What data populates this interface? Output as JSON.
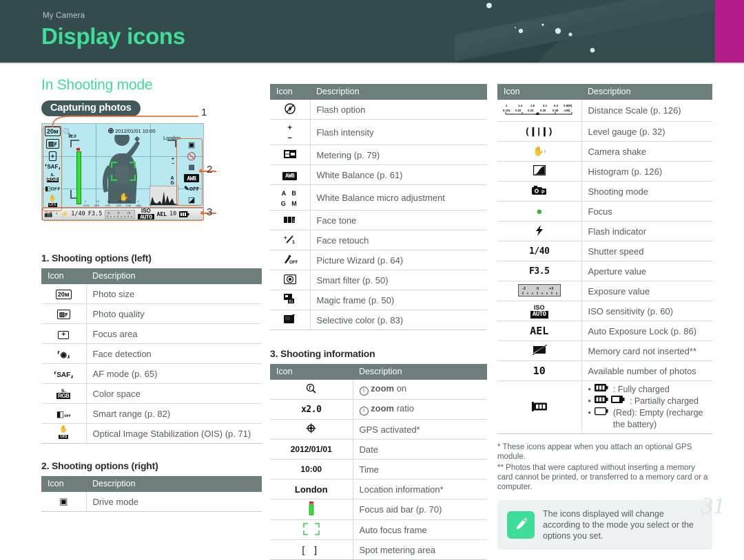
{
  "header": {
    "breadcrumb": "My Camera",
    "title": "Display icons",
    "accent_green": "#3fdd98",
    "bg": "#334b4c",
    "magenta": "#b41c8a"
  },
  "page_number": "31",
  "section": {
    "title": "In Shooting mode",
    "pill": "Capturing photos"
  },
  "callouts": {
    "one": "1",
    "two": "2",
    "three": "3"
  },
  "camera_screen": {
    "date": "2012/01/01",
    "time": "10:00",
    "location": "London",
    "zoom_ratio": "x2.0",
    "shutter_speed": "1/40",
    "aperture": "F3.5",
    "exposure_labels": [
      "-3",
      "0",
      "+3"
    ],
    "ael": "AEL",
    "photos_left": "10",
    "dist_top": [
      "1",
      "1.4",
      "1.9",
      "3.1",
      "6.4",
      "0.8(M)"
    ],
    "dist_bottom": [
      "0.101",
      "0.20",
      "0.23",
      "0.29",
      "0.48",
      "∞(M)"
    ]
  },
  "tables": {
    "left": {
      "caption": "1. Shooting options (left)",
      "columns": [
        "Icon",
        "Description"
      ],
      "rows": [
        {
          "icon": "photo-size-icon",
          "desc": "Photo size"
        },
        {
          "icon": "photo-quality-icon",
          "desc": "Photo quality"
        },
        {
          "icon": "focus-area-icon",
          "desc": "Focus area"
        },
        {
          "icon": "face-detection-icon",
          "desc": "Face detection"
        },
        {
          "icon": "af-mode-icon",
          "desc": "AF mode (p. 65)"
        },
        {
          "icon": "color-space-icon",
          "desc": "Color space"
        },
        {
          "icon": "smart-range-icon",
          "desc": "Smart range (p. 82)"
        },
        {
          "icon": "ois-icon",
          "desc": "Optical Image Stabilization (OIS) (p. 71)"
        }
      ]
    },
    "left2": {
      "caption": "2. Shooting options (right)",
      "columns": [
        "Icon",
        "Description"
      ],
      "rows": [
        {
          "icon": "drive-mode-icon",
          "desc": "Drive mode"
        }
      ]
    },
    "mid": {
      "columns": [
        "Icon",
        "Description"
      ],
      "rows": [
        {
          "icon": "flash-option-icon",
          "desc": "Flash option"
        },
        {
          "icon": "flash-intensity-icon",
          "desc": "Flash intensity"
        },
        {
          "icon": "metering-icon",
          "desc": "Metering (p. 79)"
        },
        {
          "icon": "white-balance-icon",
          "desc": "White Balance (p. 61)"
        },
        {
          "icon": "wb-micro-adjust-icon",
          "desc": "White Balance micro adjustment"
        },
        {
          "icon": "face-tone-icon",
          "desc": "Face tone"
        },
        {
          "icon": "face-retouch-icon",
          "desc": "Face retouch"
        },
        {
          "icon": "picture-wizard-icon",
          "desc": "Picture Wizard (p. 64)"
        },
        {
          "icon": "smart-filter-icon",
          "desc": "Smart filter (p. 50)"
        },
        {
          "icon": "magic-frame-icon",
          "desc": "Magic frame (p. 50)"
        },
        {
          "icon": "selective-color-icon",
          "desc": "Selective color (p. 83)"
        }
      ]
    },
    "mid2": {
      "caption": "3. Shooting information",
      "columns": [
        "Icon",
        "Description"
      ],
      "rows": [
        {
          "icon": "zoom-on-icon",
          "desc": "i zoom on",
          "desc_pre": "i",
          "desc_bold": "zoom",
          "desc_post": "on"
        },
        {
          "icon": "x2.0",
          "desc": "i zoom ratio",
          "desc_pre": "i",
          "desc_bold": "zoom",
          "desc_post": "ratio"
        },
        {
          "icon": "gps-icon",
          "desc": "GPS activated*"
        },
        {
          "icon": "2012/01/01",
          "desc": "Date"
        },
        {
          "icon": "10:00",
          "desc": "Time"
        },
        {
          "icon": "London",
          "desc": "Location information*"
        },
        {
          "icon": "focus-aid-bar-icon",
          "desc": "Focus aid bar (p. 70)"
        },
        {
          "icon": "auto-focus-frame-icon",
          "desc": "Auto focus frame"
        },
        {
          "icon": "spot-metering-icon",
          "desc": "Spot metering area"
        }
      ]
    },
    "right": {
      "columns": [
        "Icon",
        "Description"
      ],
      "rows": [
        {
          "icon": "distance-scale-icon",
          "desc": "Distance Scale (p. 126)"
        },
        {
          "icon": "level-gauge-icon",
          "desc": "Level gauge (p. 32)"
        },
        {
          "icon": "camera-shake-icon",
          "desc": "Camera shake"
        },
        {
          "icon": "histogram-icon",
          "desc": "Histogram (p. 126)"
        },
        {
          "icon": "shooting-mode-icon",
          "desc": "Shooting mode"
        },
        {
          "icon": "focus-indicator-icon",
          "desc": "Focus"
        },
        {
          "icon": "flash-indicator-icon",
          "desc": "Flash indicator"
        },
        {
          "icon": "1/40",
          "desc": "Shutter speed"
        },
        {
          "icon": "F3.5",
          "desc": "Aperture value"
        },
        {
          "icon": "exposure-value-icon",
          "desc": "Exposure value"
        },
        {
          "icon": "iso-icon",
          "desc": "ISO sensitivity (p. 60)"
        },
        {
          "icon": "AEL",
          "desc": "Auto Exposure Lock (p. 86)"
        },
        {
          "icon": "no-memory-card-icon",
          "desc": "Memory card not inserted**"
        },
        {
          "icon": "10",
          "desc": "Available number of photos"
        },
        {
          "icon": "battery-icon",
          "desc": "battery-levels"
        }
      ],
      "battery_bullets": [
        {
          "icon": "battery-full-icon",
          "text": ": Fully charged"
        },
        {
          "icon": "battery-partial-icon",
          "text": ": Partially charged"
        },
        {
          "icon": "battery-empty-icon",
          "text": " (Red): Empty (recharge the battery)"
        }
      ]
    }
  },
  "footnotes": {
    "one": "* These icons appear when you attach an optional GPS module.",
    "two": "** Photos that were captured without inserting a memory card cannot be printed, or transferred to a memory card or a computer."
  },
  "tip": {
    "icon": "pen-note-icon",
    "text": "The icons displayed will change according to the mode you select or the options you set."
  }
}
